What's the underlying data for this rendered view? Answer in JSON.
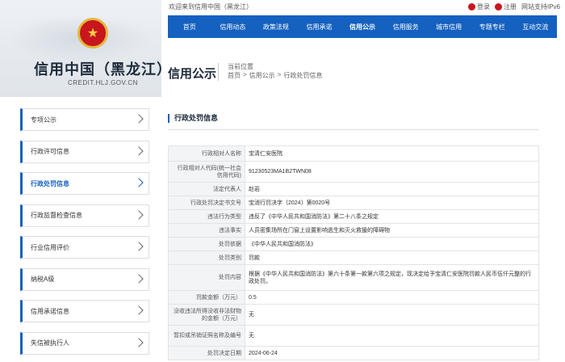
{
  "header": {
    "site_title": "信用中国（黑龙江）",
    "site_domain": "CREDIT.HLJ.GOV.CN",
    "welcome": "欢迎来到信用中国（黑龙江）",
    "login": "登录",
    "register": "注册",
    "ipv6": "网站支持IPv6"
  },
  "nav": [
    "首页",
    "信用动态",
    "政策法规",
    "信用承诺",
    "信用公示",
    "信用服务",
    "城市信用",
    "专题专栏",
    "互动交流"
  ],
  "page": {
    "section_title": "信用公示",
    "breadcrumb_label": "当前位置",
    "breadcrumb": [
      "首页",
      "信用公示",
      "行政处罚信息"
    ],
    "breadcrumb_sep": ">"
  },
  "sidebar": {
    "items": [
      "专项公示",
      "行政许可信息",
      "行政处罚信息",
      "行政监督检查信息",
      "行业信用评价",
      "纳税A级",
      "信用承诺信息",
      "失信被执行人"
    ],
    "active_index": 2
  },
  "content": {
    "title": "行政处罚信息",
    "rows": [
      {
        "label": "行政相对人名称",
        "value": "宝清仁安医院"
      },
      {
        "label": "行政相对人代码(统一社会信用代码)",
        "value": "91230523MA1B2TWN08"
      },
      {
        "label": "法定代表人",
        "value": "赵岩"
      },
      {
        "label": "行政处罚决定书文号",
        "value": "宝消行罚决字〔2024〕第0020号"
      },
      {
        "label": "违法行为类型",
        "value": "违反了《中华人民共和国消防法》第二十八条之规定"
      },
      {
        "label": "违法事实",
        "value": "人员密集场所在门窗上设置影响逃生和灭火救援的障碍物"
      },
      {
        "label": "处罚依据",
        "value": "《中华人民共和国消防法》"
      },
      {
        "label": "处罚类别",
        "value": "罚款"
      },
      {
        "label": "处罚内容",
        "value": "根据《中华人民共和国消防法》第六十条第一款第六项之规定，现决定给予宝清仁安医院罚款人民币伍仟元整的行政处罚。"
      },
      {
        "label": "罚款金额（万元）",
        "value": "0.5"
      },
      {
        "label": "没收违法所得没收非法财物的金额（万元）",
        "value": "无"
      },
      {
        "label": "暂扣或吊销证照名称及编号",
        "value": "无"
      },
      {
        "label": "处罚决定日期",
        "value": "2024-06-24"
      }
    ]
  },
  "colors": {
    "nav_bg": "#1561c0",
    "accent": "#1561c0",
    "emblem_red": "#c8161d"
  }
}
